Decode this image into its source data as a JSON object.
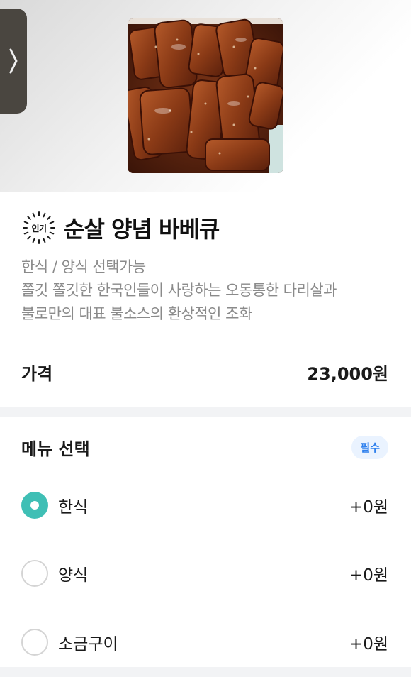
{
  "product": {
    "badge_label": "인기",
    "title": "순살 양념 바베큐",
    "description_lines": [
      "한식 / 양식 선택가능",
      "쫄깃 쫄깃한 한국인들이 사랑하는 오동통한 다리살과",
      "불로만의 대표 불소스의 환상적인 조화"
    ],
    "image_icon": "food-photo"
  },
  "price": {
    "label": "가격",
    "value": "23,000원"
  },
  "menu": {
    "title": "메뉴 선택",
    "required_label": "필수",
    "options": [
      {
        "label": "한식",
        "price": "+0원",
        "selected": true
      },
      {
        "label": "양식",
        "price": "+0원",
        "selected": false
      },
      {
        "label": "소금구이",
        "price": "+0원",
        "selected": false
      }
    ]
  },
  "side_tab": {
    "icon": "chevron-right-icon"
  },
  "colors": {
    "accent": "#3fbfb5",
    "required_badge_bg": "#eaf3ff",
    "required_badge_text": "#2f80ed",
    "divider": "#f2f3f5"
  }
}
